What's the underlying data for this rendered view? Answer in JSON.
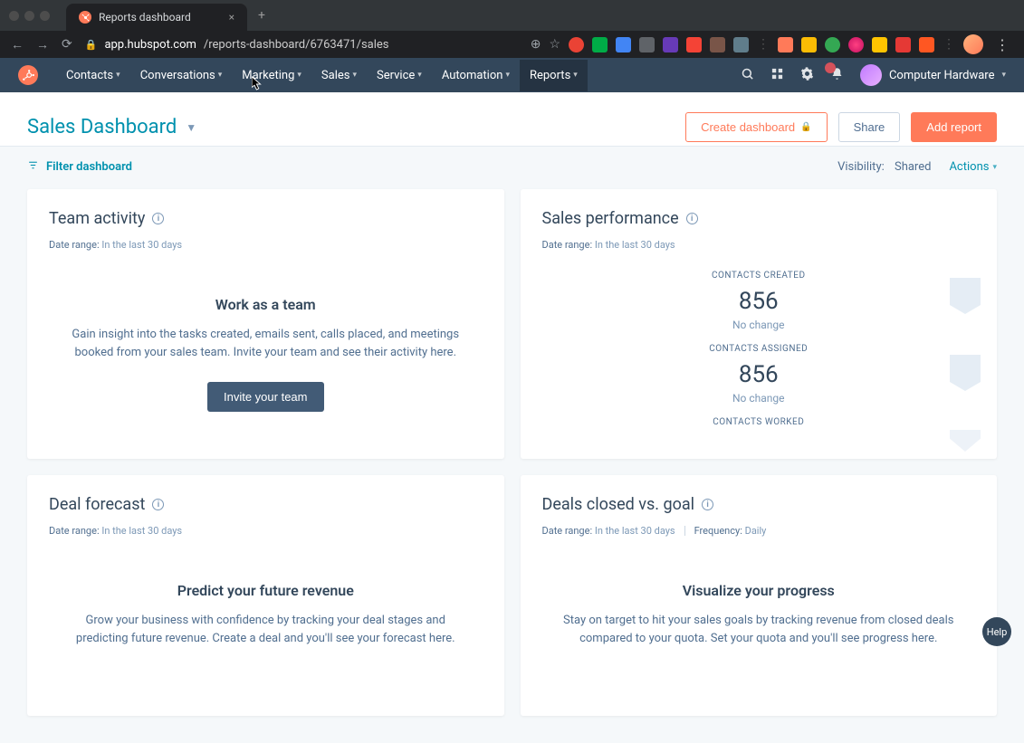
{
  "browser": {
    "tab_title": "Reports dashboard",
    "url_display": "app.hubspot.com/reports-dashboard/6763471/sales",
    "url_domain": "app.hubspot.com",
    "url_path": "/reports-dashboard/6763471/sales"
  },
  "nav": {
    "items": [
      {
        "label": "Contacts"
      },
      {
        "label": "Conversations"
      },
      {
        "label": "Marketing"
      },
      {
        "label": "Sales"
      },
      {
        "label": "Service"
      },
      {
        "label": "Automation"
      },
      {
        "label": "Reports"
      }
    ],
    "account_label": "Computer Hardware"
  },
  "header": {
    "title": "Sales Dashboard",
    "create_label": "Create dashboard",
    "share_label": "Share",
    "add_label": "Add report"
  },
  "filter_row": {
    "filter_label": "Filter dashboard",
    "visibility_label": "Visibility:",
    "visibility_value": "Shared",
    "actions_label": "Actions"
  },
  "cards": {
    "team": {
      "title": "Team activity",
      "range_label": "Date range:",
      "range_value": "In the last 30 days",
      "empty_title": "Work as a team",
      "empty_body": "Gain insight into the tasks created, emails sent, calls placed, and meetings booked from your sales team. Invite your team and see their activity here.",
      "cta": "Invite your team"
    },
    "sales_perf": {
      "title": "Sales performance",
      "range_label": "Date range:",
      "range_value": "In the last 30 days",
      "metrics": [
        {
          "label": "CONTACTS CREATED",
          "value": "856",
          "change": "No change"
        },
        {
          "label": "CONTACTS ASSIGNED",
          "value": "856",
          "change": "No change"
        },
        {
          "label": "CONTACTS WORKED",
          "value": "",
          "change": ""
        }
      ]
    },
    "forecast": {
      "title": "Deal forecast",
      "range_label": "Date range:",
      "range_value": "In the last 30 days",
      "empty_title": "Predict your future revenue",
      "empty_body": "Grow your business with confidence by tracking your deal stages and predicting future revenue. Create a deal and you'll see your forecast here."
    },
    "closed_goal": {
      "title": "Deals closed vs. goal",
      "range_label": "Date range:",
      "range_value": "In the last 30 days",
      "freq_label": "Frequency:",
      "freq_value": "Daily",
      "empty_title": "Visualize your progress",
      "empty_body": "Stay on target to hit your sales goals by tracking revenue from closed deals compared to your quota. Set your quota and you'll see progress here."
    }
  },
  "help": {
    "label": "Help"
  }
}
